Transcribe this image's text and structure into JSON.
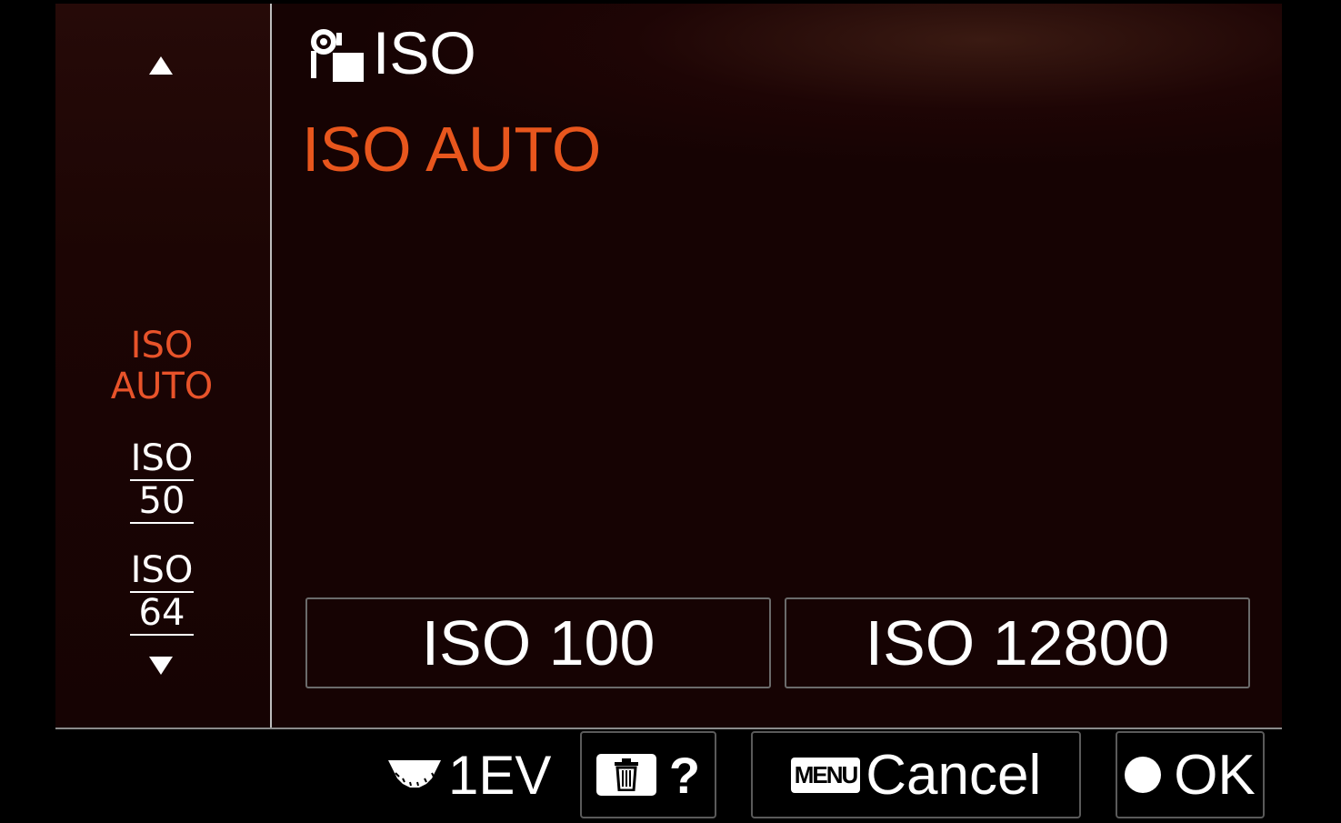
{
  "header": {
    "title": "ISO",
    "title_icon": "camera-photo-settings-icon",
    "selected_value": "ISO AUTO"
  },
  "list": {
    "scroll_up_icon": "triangle-up-icon",
    "scroll_down_icon": "triangle-down-icon",
    "items": [
      {
        "line1": "ISO",
        "line2": "AUTO",
        "selected": true
      },
      {
        "line1": "ISO",
        "line2": "50",
        "selected": false
      },
      {
        "line1": "ISO",
        "line2": "64",
        "selected": false
      }
    ]
  },
  "auto_range": {
    "min": "ISO 100",
    "max": "ISO 12800"
  },
  "footer": {
    "step_label": "1EV",
    "step_icon": "control-dial-icon",
    "help_icon": "trash-icon",
    "help_label": "?",
    "cancel_badge": "MENU",
    "cancel_label": "Cancel",
    "ok_icon": "center-button-icon",
    "ok_label": "OK"
  },
  "colors": {
    "accent": "#e8561d",
    "background": "#160303"
  }
}
